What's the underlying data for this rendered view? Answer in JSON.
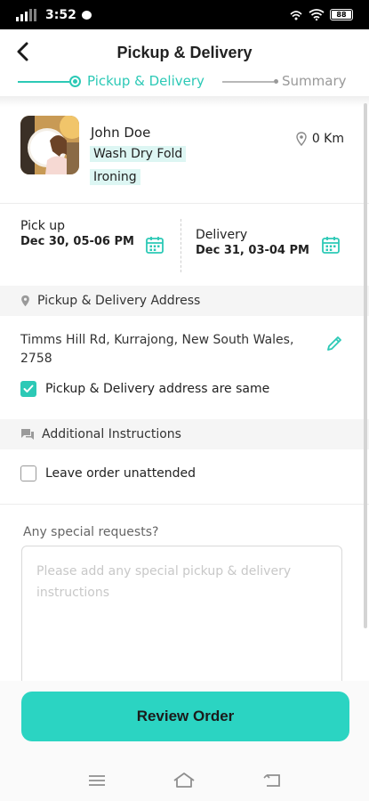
{
  "status_bar": {
    "time": "3:52",
    "battery": "88"
  },
  "header": {
    "title": "Pickup & Delivery"
  },
  "stepper": {
    "steps": [
      {
        "label": "Pickup & Delivery",
        "state": "active"
      },
      {
        "label": "Summary",
        "state": "inactive"
      }
    ]
  },
  "customer": {
    "name": "John Doe",
    "services": [
      "Wash Dry Fold",
      "Ironing"
    ],
    "distance": "0 Km"
  },
  "schedule": {
    "pickup": {
      "title": "Pick up",
      "value": "Dec 30, 05-06 PM"
    },
    "delivery": {
      "title": "Delivery",
      "value": "Dec 31, 03-04 PM"
    }
  },
  "address_section": {
    "heading": "Pickup & Delivery Address",
    "address": "Timms Hill Rd, Kurrajong, New South Wales, 2758",
    "same_address_label": "Pickup & Delivery address are same",
    "same_address_checked": true
  },
  "instructions_section": {
    "heading": "Additional Instructions",
    "unattended_label": "Leave order unattended",
    "unattended_checked": false,
    "special_label": "Any special requests?",
    "special_placeholder": "Please add any special pickup & delivery instructions",
    "special_value": ""
  },
  "actions": {
    "review_label": "Review Order"
  },
  "colors": {
    "accent": "#2cc9b6",
    "button": "#2bd4c2",
    "tag_bg": "#ddf6f3"
  },
  "icons": {
    "back": "arrow-left-icon",
    "location": "map-pin-icon",
    "calendar": "calendar-icon",
    "edit": "pencil-icon",
    "chat": "chat-bubble-icon",
    "nav": [
      "menu-icon",
      "home-icon",
      "back-icon"
    ]
  }
}
